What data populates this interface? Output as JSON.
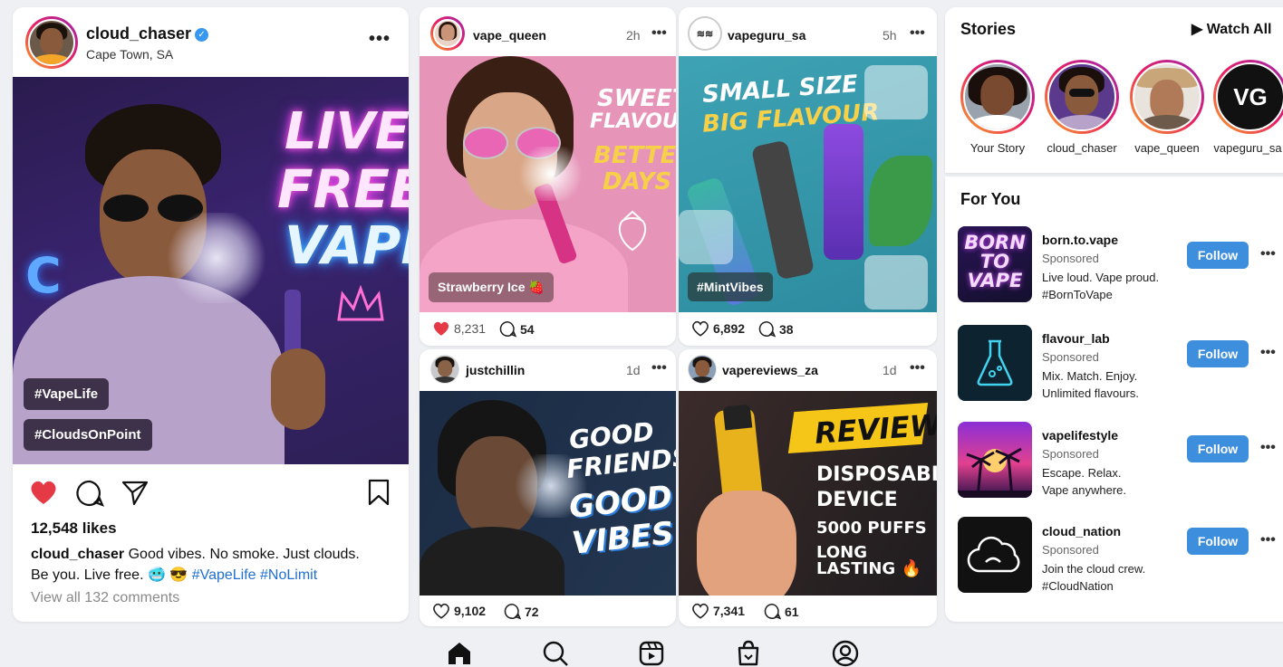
{
  "main_post": {
    "username": "cloud_chaser",
    "location": "Cape Town, SA",
    "neon_lines": [
      "LIVE",
      "FREE",
      "VAPE"
    ],
    "neon_letter": "C",
    "tags": [
      "#VapeLife",
      "#CloudsOnPoint"
    ],
    "likes": "12,548 likes",
    "caption_user": "cloud_chaser",
    "caption_text_1": "Good vibes. No smoke. Just clouds.",
    "caption_text_2": "Be you. Live free. 🥶 😎",
    "caption_tags": "#VapeLife #NoLimit",
    "comments": "View all 132 comments",
    "liked": true
  },
  "grid_posts": [
    {
      "username": "vape_queen",
      "time": "2h",
      "poster_lines": [
        "SWEET",
        "FLAVOURS",
        "BETTER",
        "DAYS"
      ],
      "chip": "Strawberry Ice 🍓",
      "likes": "8,231",
      "comments": "54",
      "liked": true
    },
    {
      "username": "vapeguru_sa",
      "time": "5h",
      "poster_lines": [
        "SMALL SIZE",
        "BIG FLAVOUR"
      ],
      "chip": "#MintVibes",
      "likes": "6,892",
      "comments": "38",
      "liked": false
    },
    {
      "username": "justchillin",
      "time": "1d",
      "poster_lines": [
        "GOOD",
        "FRIENDS",
        "GOOD",
        "VIBES"
      ],
      "likes": "9,102",
      "comments": "72",
      "liked": false
    },
    {
      "username": "vapereviews_za",
      "time": "1d",
      "poster_lines": [
        "REVIEW",
        "DISPOSABLE",
        "DEVICE",
        "5000 PUFFS",
        "LONG LASTING 🔥"
      ],
      "likes": "7,341",
      "comments": "61",
      "liked": false
    }
  ],
  "stories": {
    "title": "Stories",
    "watch_all": "▶ Watch All",
    "items": [
      {
        "label": "Your Story"
      },
      {
        "label": "cloud_chaser"
      },
      {
        "label": "vape_queen"
      },
      {
        "label": "vapeguru_sa",
        "avatar_text": "VG"
      }
    ]
  },
  "for_you": {
    "title": "For You",
    "follow_label": "Follow",
    "sponsored_label": "Sponsored",
    "items": [
      {
        "name": "born.to.vape",
        "line1": "Live loud. Vape proud.",
        "line2": "#BornToVape",
        "thumb_text": "BORN TO VAPE"
      },
      {
        "name": "flavour_lab",
        "line1": "Mix. Match. Enjoy.",
        "line2": "Unlimited flavours."
      },
      {
        "name": "vapelifestyle",
        "line1": "Escape. Relax.",
        "line2": "Vape anywhere."
      },
      {
        "name": "cloud_nation",
        "line1": "Join the cloud crew.",
        "line2": "#CloudNation"
      }
    ]
  },
  "nav": [
    "home-icon",
    "search-icon",
    "reels-icon",
    "shop-icon",
    "profile-icon"
  ],
  "colors": {
    "like": "#e63946",
    "follow": "#3e8ede",
    "link": "#1f6fd1",
    "verified": "#3897f0"
  }
}
